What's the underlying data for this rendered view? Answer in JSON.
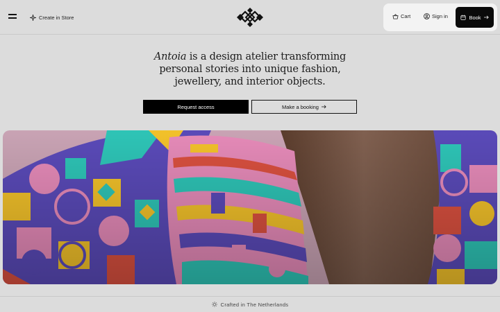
{
  "header": {
    "create_label": "Create in Store",
    "cart_label": "Cart",
    "signin_label": "Sign in",
    "book_label": "Book"
  },
  "hero": {
    "brand": "Antoia",
    "headline_rest": " is a design atelier transforming personal stories into unique fashion, jewellery, and interior objects.",
    "primary_cta": "Request access",
    "secondary_cta": "Make a booking"
  },
  "footer": {
    "crafted": "Crafted in The Netherlands"
  },
  "icons": {
    "menu": "hamburger-icon",
    "create": "sparkle-icon",
    "logo": "diamond-knot-logo",
    "cart": "basket-icon",
    "signin": "user-icon",
    "book": "calendar-icon",
    "arrow": "arrow-right-icon",
    "crafted": "sun-icon"
  },
  "colors": {
    "background": "#dcdcdc",
    "primary": "#000000",
    "actions_panel": "#f3f3f3"
  }
}
